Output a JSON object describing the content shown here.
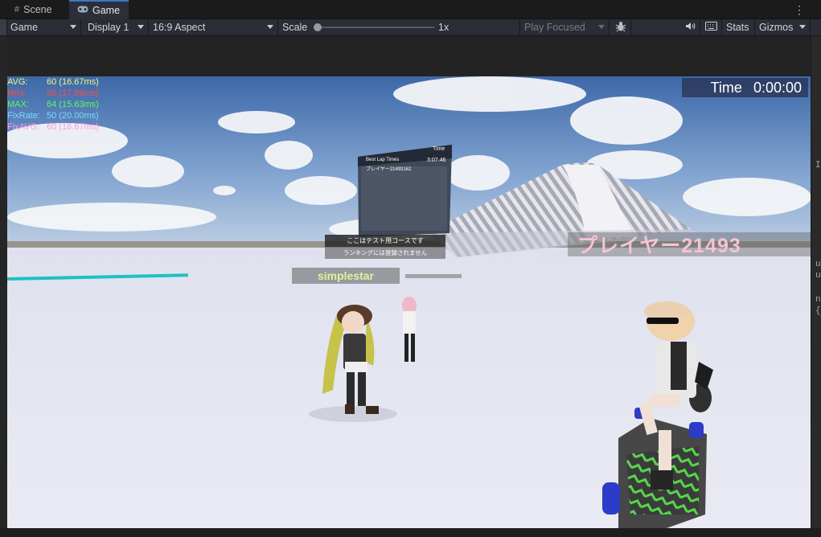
{
  "tabs": {
    "scene": {
      "label": "Scene",
      "icon": "grid-icon"
    },
    "game": {
      "label": "Game",
      "icon": "gamepad-icon"
    }
  },
  "toolbar": {
    "game_select": "Game",
    "display_select": "Display 1",
    "aspect_select": "16:9 Aspect",
    "scale_label": "Scale",
    "scale_value": "1x",
    "play_mode_select": "Play Focused",
    "stats_label": "Stats",
    "gizmos_label": "Gizmos"
  },
  "stats": {
    "avg_label": "AVG:",
    "avg_value": "60 (16.67ms)",
    "min_label": "MIN:",
    "min_value": "56 (17.86ms)",
    "max_label": "MAX:",
    "max_value": "64 (15.63ms)",
    "fixrate_label": "FixRate:",
    "fixrate_value": "50 (20.00ms)",
    "fixavg_label": "FixAVG:",
    "fixavg_value": "60 (16.67ms)"
  },
  "hud": {
    "time_label": "Time",
    "time_value": "0:00:00"
  },
  "world": {
    "leaderboard_title": "Best Lap Times",
    "leaderboard_time_header": "Time",
    "leaderboard_player": "プレイヤー21493162",
    "leaderboard_laptime": "3:07.46",
    "message_line1": "ここはテスト用コースです",
    "message_line2": "ランキングには登録されません",
    "name_simplestar": "simplestar",
    "name_player": "プレイヤー21493"
  },
  "right_panel_fragments": [
    "In",
    "u",
    "u",
    "n",
    "{"
  ],
  "colors": {
    "tab_active_accent": "#3a78c9",
    "stat_avg": "#f5f57a",
    "stat_min": "#ff4c4c",
    "stat_max": "#56ff56",
    "stat_fixrate": "#7fd6ff",
    "stat_fixavg": "#ff9cdc"
  }
}
